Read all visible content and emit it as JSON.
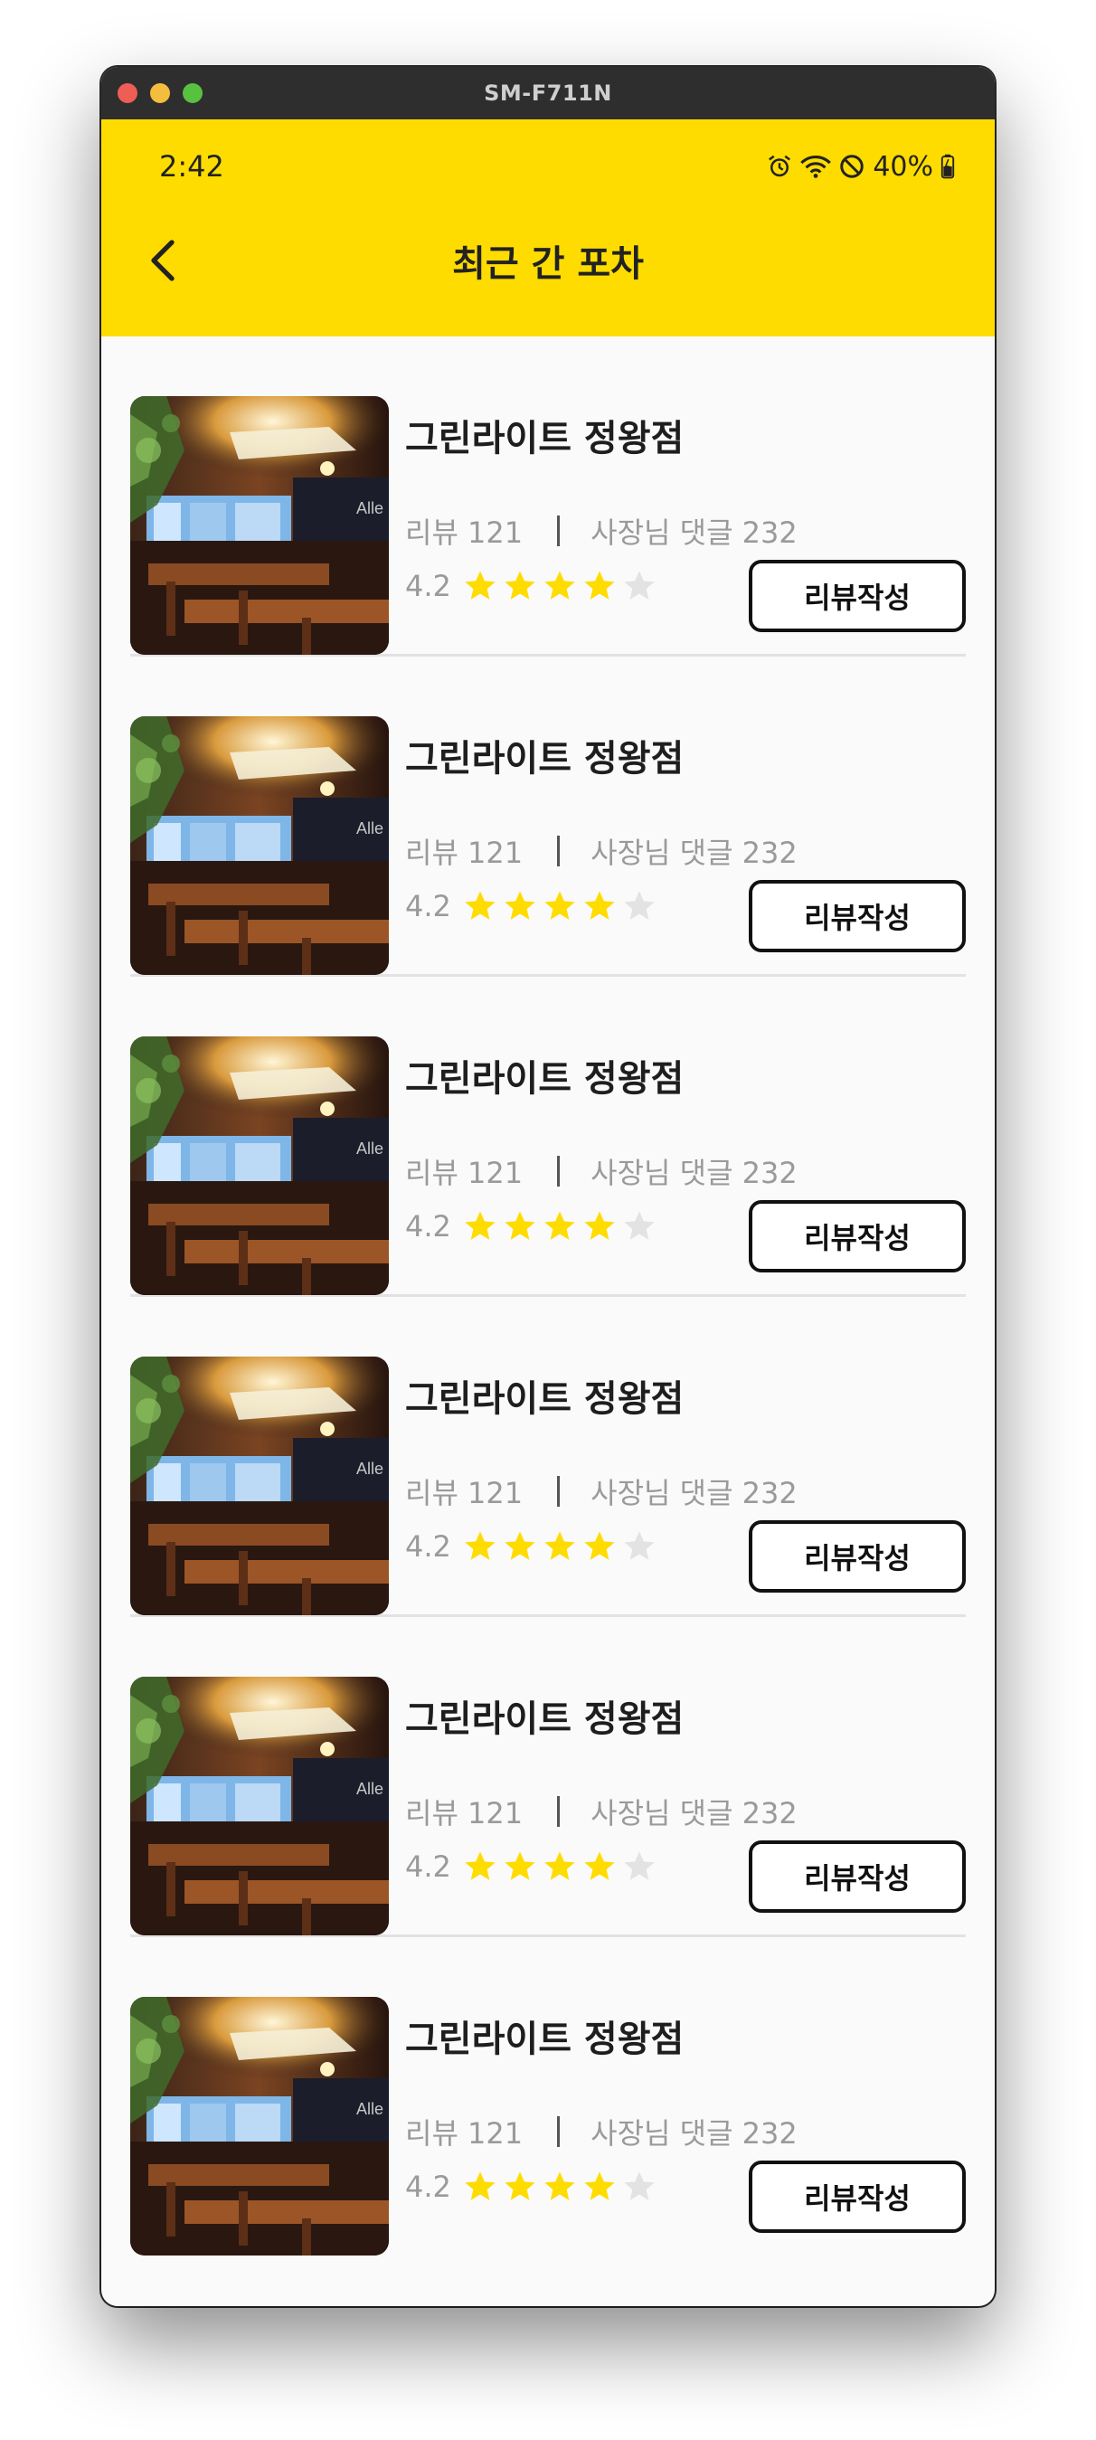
{
  "window": {
    "title": "SM-F711N"
  },
  "status_bar": {
    "time": "2:42",
    "battery": "40%"
  },
  "app_bar": {
    "title": "최근 간 포차"
  },
  "colors": {
    "brand_yellow": "#ffdc00",
    "star_on": "#ffdc00",
    "star_off": "#e3e3e3"
  },
  "items": [
    {
      "name": "그린라이트 정왕점",
      "reviews": "리뷰 121",
      "owner_replies": "사장님 댓글 232",
      "rating": "4.2",
      "stars": 4,
      "button": "리뷰작성"
    },
    {
      "name": "그린라이트 정왕점",
      "reviews": "리뷰 121",
      "owner_replies": "사장님 댓글 232",
      "rating": "4.2",
      "stars": 4,
      "button": "리뷰작성"
    },
    {
      "name": "그린라이트 정왕점",
      "reviews": "리뷰 121",
      "owner_replies": "사장님 댓글 232",
      "rating": "4.2",
      "stars": 4,
      "button": "리뷰작성"
    },
    {
      "name": "그린라이트 정왕점",
      "reviews": "리뷰 121",
      "owner_replies": "사장님 댓글 232",
      "rating": "4.2",
      "stars": 4,
      "button": "리뷰작성"
    },
    {
      "name": "그린라이트 정왕점",
      "reviews": "리뷰 121",
      "owner_replies": "사장님 댓글 232",
      "rating": "4.2",
      "stars": 4,
      "button": "리뷰작성"
    },
    {
      "name": "그린라이트 정왕점",
      "reviews": "리뷰 121",
      "owner_replies": "사장님 댓글 232",
      "rating": "4.2",
      "stars": 4,
      "button": "리뷰작성"
    }
  ]
}
